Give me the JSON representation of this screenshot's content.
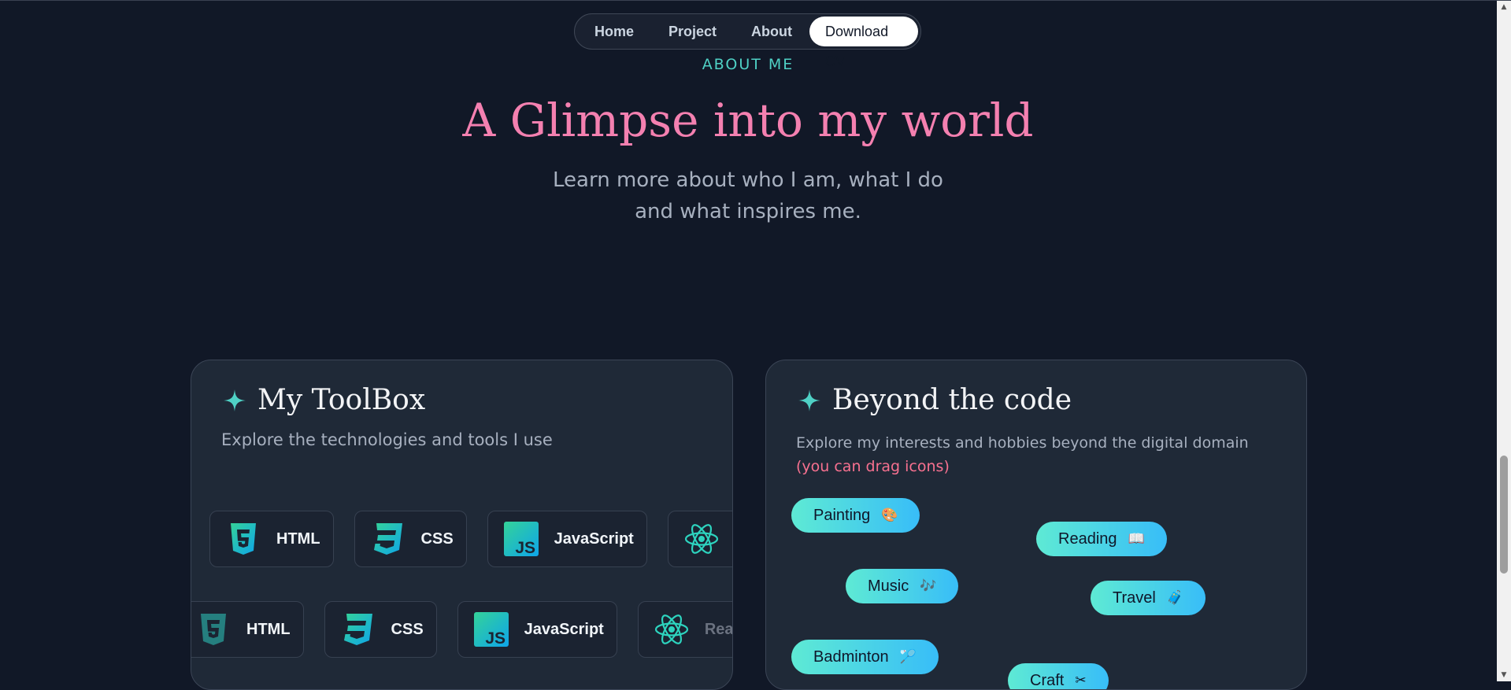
{
  "nav": {
    "items": [
      "Home",
      "Project",
      "About"
    ],
    "cta": "Download CV"
  },
  "hero": {
    "eyebrow": "ABOUT ME",
    "title": "A Glimpse into my world",
    "subtitle_line1": "Learn more about who I am, what I do",
    "subtitle_line2": "and what inspires me."
  },
  "toolbox": {
    "title": "My ToolBox",
    "description": "Explore the technologies and tools I use",
    "row1": [
      "HTML",
      "CSS",
      "JavaScript",
      "R"
    ],
    "row2": [
      "HTML",
      "CSS",
      "JavaScript",
      "Reac"
    ]
  },
  "beyond": {
    "title": "Beyond the code",
    "description": "Explore my interests and hobbies beyond the digital domain",
    "note": "(you can drag icons)",
    "hobbies": [
      {
        "label": "Painting",
        "icon": "🎨"
      },
      {
        "label": "Reading",
        "icon": "📖"
      },
      {
        "label": "Music",
        "icon": "🎶"
      },
      {
        "label": "Travel",
        "icon": "🧳"
      },
      {
        "label": "Badminton",
        "icon": "🏸"
      },
      {
        "label": "Craft",
        "icon": "✂"
      }
    ]
  },
  "colors": {
    "background": "#111827",
    "card": "#1f2937",
    "accent_teal": "#4fd1c5",
    "title_pink": "#f480b0",
    "chip_from": "#5eead4",
    "chip_to": "#38bdf8"
  }
}
